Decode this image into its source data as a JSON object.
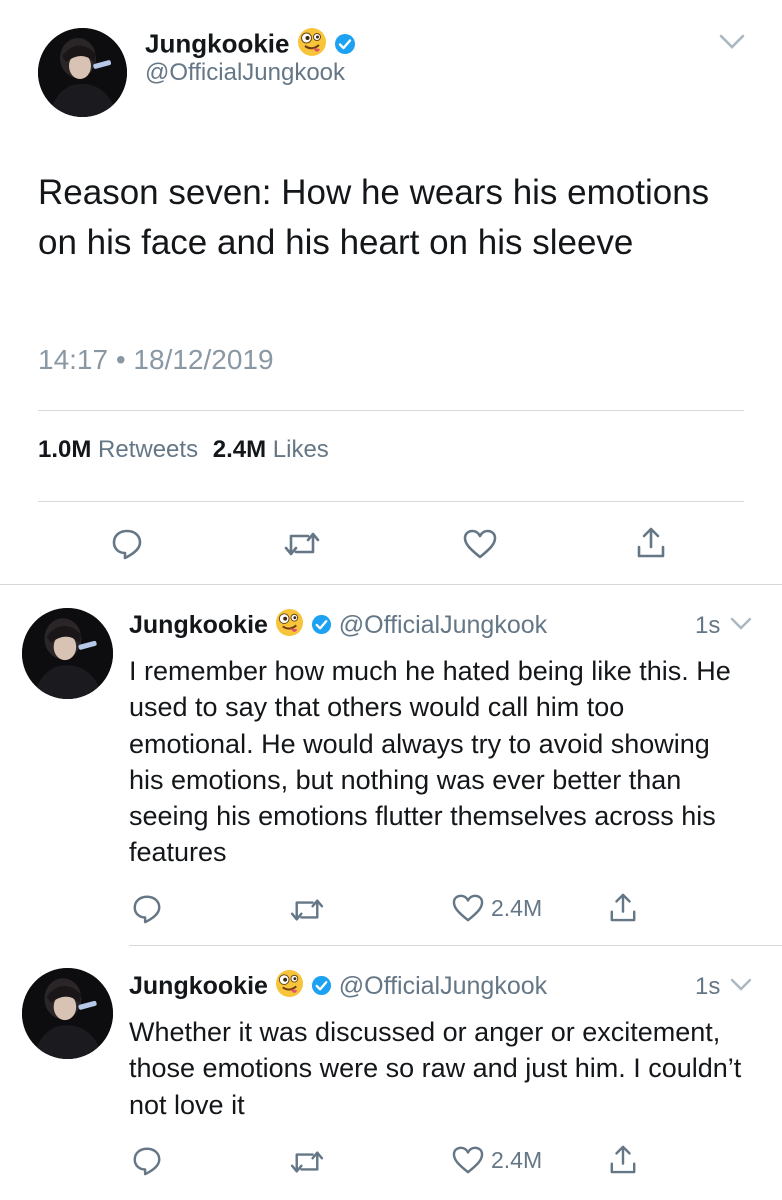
{
  "main_tweet": {
    "display_name": "Jungkookie",
    "handle": "@OfficialJungkook",
    "text": "Reason seven: How he wears his emotions on his face and his heart on his sleeve",
    "timestamp": "14:17 • 18/12/2019",
    "retweets_count": "1.0M",
    "retweets_label": "Retweets",
    "likes_count": "2.4M",
    "likes_label": "Likes"
  },
  "replies": [
    {
      "display_name": "Jungkookie",
      "handle": "@OfficialJungkook",
      "time": "1s",
      "text": "I remember how much he hated being like this. He used to say that others would call him too emotional. He would always try to avoid showing his emotions, but nothing was ever better than seeing his emotions flutter themselves across his features",
      "like_count": "2.4M"
    },
    {
      "display_name": "Jungkookie",
      "handle": "@OfficialJungkook",
      "time": "1s",
      "text": "Whether it was discussed or anger or excitement, those emotions were so raw and just him. I couldn’t not love it",
      "like_count": "2.4M"
    }
  ],
  "icons": {
    "reply": "reply-icon",
    "retweet": "retweet-icon",
    "like": "heart-icon",
    "share": "share-icon",
    "verified": "verified-badge-icon",
    "emoji": "zany-face-emoji",
    "more": "chevron-down-icon"
  },
  "colors": {
    "verified_blue": "#1da1f2",
    "secondary_text": "#657786",
    "primary_text": "#14171a"
  }
}
